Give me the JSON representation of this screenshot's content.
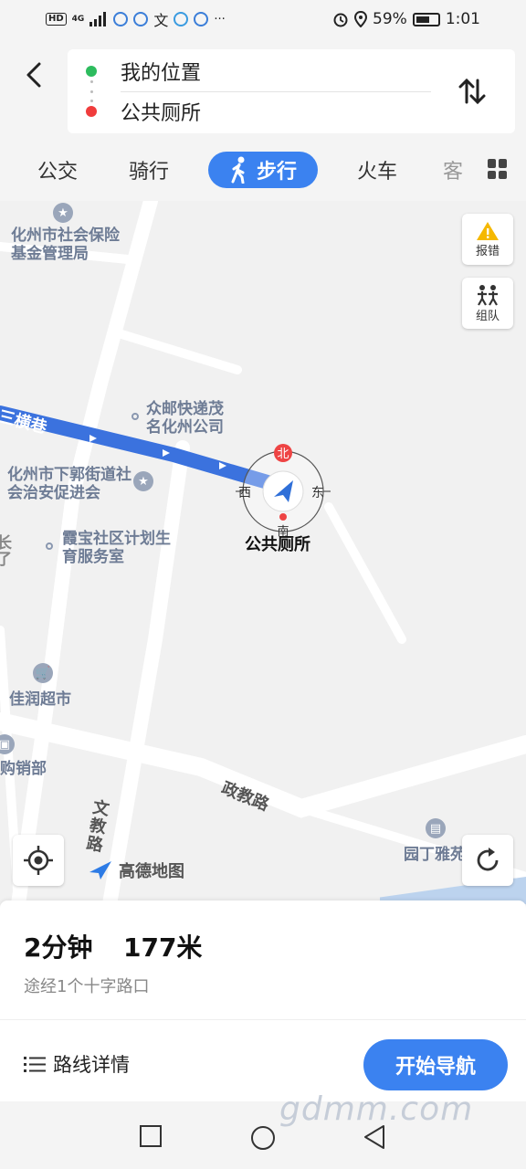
{
  "status_bar": {
    "left_badges": [
      "HD",
      "4G"
    ],
    "battery": "59%",
    "time": "1:01",
    "more": "···"
  },
  "route": {
    "from": "我的位置",
    "to": "公共厕所"
  },
  "tabs": [
    {
      "label": "公交",
      "active": false
    },
    {
      "label": "骑行",
      "active": false
    },
    {
      "label": "步行",
      "active": true
    },
    {
      "label": "火车",
      "active": false
    },
    {
      "label": "客",
      "active": false
    }
  ],
  "map": {
    "pois": {
      "social_insurance": "化州市社会保险基金管理局",
      "express": "众邮快递茂名化州公司",
      "street_office": "化州市下郭街道社会治安促进会",
      "family_planning": "霞宝社区计划生育服务室",
      "supermarket": "佳润超市",
      "shop": "购销部",
      "yading": "园丁雅苑"
    },
    "roads": {
      "hengxiang": "三横巷",
      "zhengjiao": "政教路",
      "wenjiao": "文教路"
    },
    "edge_text": "长了",
    "destination_label": "公共厕所",
    "compass": {
      "north": "北",
      "south": "南",
      "east": "东",
      "west": "西"
    },
    "buttons": {
      "report": "报错",
      "team": "组队"
    },
    "logo": "高德地图"
  },
  "summary": {
    "time": "2分钟",
    "distance": "177米",
    "via": "途经1个十字路口"
  },
  "actions": {
    "details": "路线详情",
    "start": "开始导航"
  },
  "watermark": "gdmm.com",
  "colors": {
    "accent": "#3b82f0",
    "start_dot": "#2dbc5e",
    "end_dot": "#f03c3c",
    "route": "#3b72de"
  }
}
